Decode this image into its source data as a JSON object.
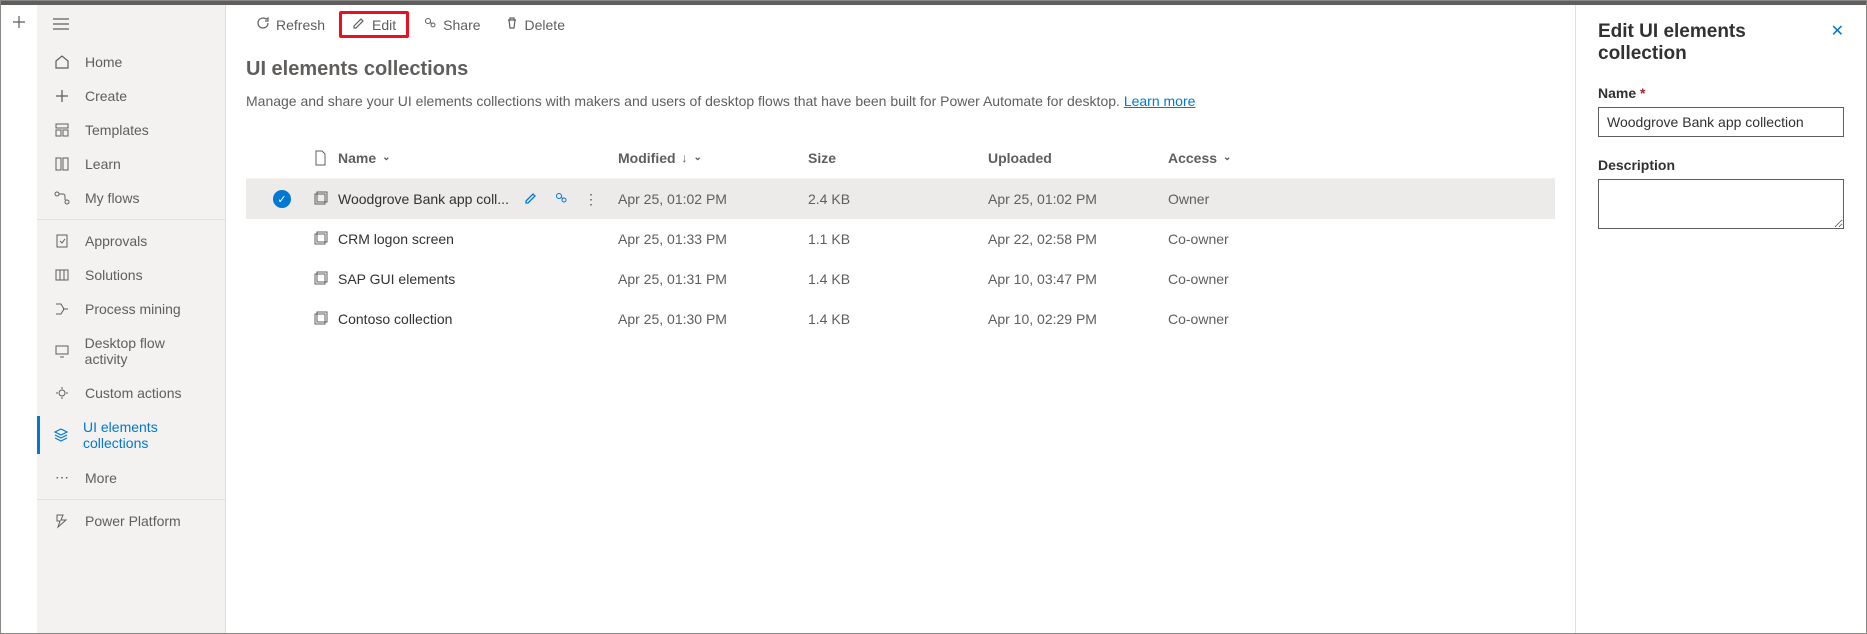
{
  "sidebar": {
    "items": [
      {
        "label": "Home",
        "iconName": "home-icon"
      },
      {
        "label": "Create",
        "iconName": "plus-icon"
      },
      {
        "label": "Templates",
        "iconName": "templates-icon"
      },
      {
        "label": "Learn",
        "iconName": "learn-icon"
      },
      {
        "label": "My flows",
        "iconName": "flows-icon"
      }
    ],
    "items2": [
      {
        "label": "Approvals",
        "iconName": "approvals-icon"
      },
      {
        "label": "Solutions",
        "iconName": "solutions-icon"
      },
      {
        "label": "Process mining",
        "iconName": "process-mining-icon"
      },
      {
        "label": "Desktop flow activity",
        "iconName": "desktop-activity-icon"
      },
      {
        "label": "Custom actions",
        "iconName": "custom-actions-icon"
      },
      {
        "label": "UI elements collections",
        "iconName": "ui-elements-icon",
        "active": true
      },
      {
        "label": "More",
        "iconName": "more-icon"
      }
    ],
    "items3": [
      {
        "label": "Power Platform",
        "iconName": "power-platform-icon"
      }
    ]
  },
  "toolbar": {
    "refresh": "Refresh",
    "edit": "Edit",
    "share": "Share",
    "delete": "Delete"
  },
  "page": {
    "title": "UI elements collections",
    "description": "Manage and share your UI elements collections with makers and users of desktop flows that have been built for Power Automate for desktop. ",
    "learnMore": "Learn more"
  },
  "table": {
    "columns": {
      "name": "Name",
      "modified": "Modified",
      "size": "Size",
      "uploaded": "Uploaded",
      "access": "Access"
    },
    "rows": [
      {
        "name": "Woodgrove Bank app coll...",
        "modified": "Apr 25, 01:02 PM",
        "size": "2.4 KB",
        "uploaded": "Apr 25, 01:02 PM",
        "access": "Owner",
        "selected": true
      },
      {
        "name": "CRM logon screen",
        "modified": "Apr 25, 01:33 PM",
        "size": "1.1 KB",
        "uploaded": "Apr 22, 02:58 PM",
        "access": "Co-owner"
      },
      {
        "name": "SAP GUI elements",
        "modified": "Apr 25, 01:31 PM",
        "size": "1.4 KB",
        "uploaded": "Apr 10, 03:47 PM",
        "access": "Co-owner"
      },
      {
        "name": "Contoso collection",
        "modified": "Apr 25, 01:30 PM",
        "size": "1.4 KB",
        "uploaded": "Apr 10, 02:29 PM",
        "access": "Co-owner"
      }
    ]
  },
  "panel": {
    "title": "Edit UI elements collection",
    "nameLabel": "Name",
    "nameValue": "Woodgrove Bank app collection",
    "descriptionLabel": "Description",
    "descriptionValue": ""
  }
}
